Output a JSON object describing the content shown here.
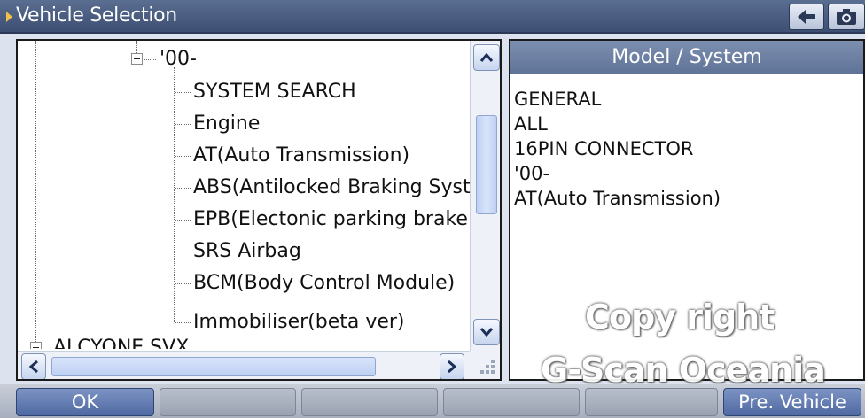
{
  "window": {
    "title": "Vehicle Selection"
  },
  "titlebar": {
    "back_icon": "back-arrow-icon",
    "camera_icon": "camera-icon"
  },
  "tree": {
    "parent_label": "'00-",
    "children": [
      "SYSTEM SEARCH",
      "Engine",
      "AT(Auto Transmission)",
      "ABS(Antilocked Braking Syst",
      "EPB(Electonic parking brake",
      "SRS Airbag",
      "BCM(Body Control Module)",
      "Immobiliser(beta ver)"
    ],
    "partial_next_item": "ALCYONE SVX"
  },
  "model_panel": {
    "header": "Model / System",
    "items": [
      "GENERAL",
      "ALL",
      "16PIN CONNECTOR",
      "'00-",
      "AT(Auto Transmission)"
    ]
  },
  "watermark": {
    "line1": "Copy right",
    "line2": "G-Scan Oceania"
  },
  "bottom_bar": {
    "buttons": [
      {
        "label": "OK",
        "active": true
      },
      {
        "label": "",
        "active": false
      },
      {
        "label": "",
        "active": false
      },
      {
        "label": "",
        "active": false
      },
      {
        "label": "",
        "active": false
      },
      {
        "label": "Pre. Vehicle",
        "active": true
      }
    ]
  },
  "colors": {
    "titlebar": "#4a5c80",
    "header": "#6f82a6",
    "active_button": "#5f78ad",
    "inactive_button": "#aab1bf"
  }
}
